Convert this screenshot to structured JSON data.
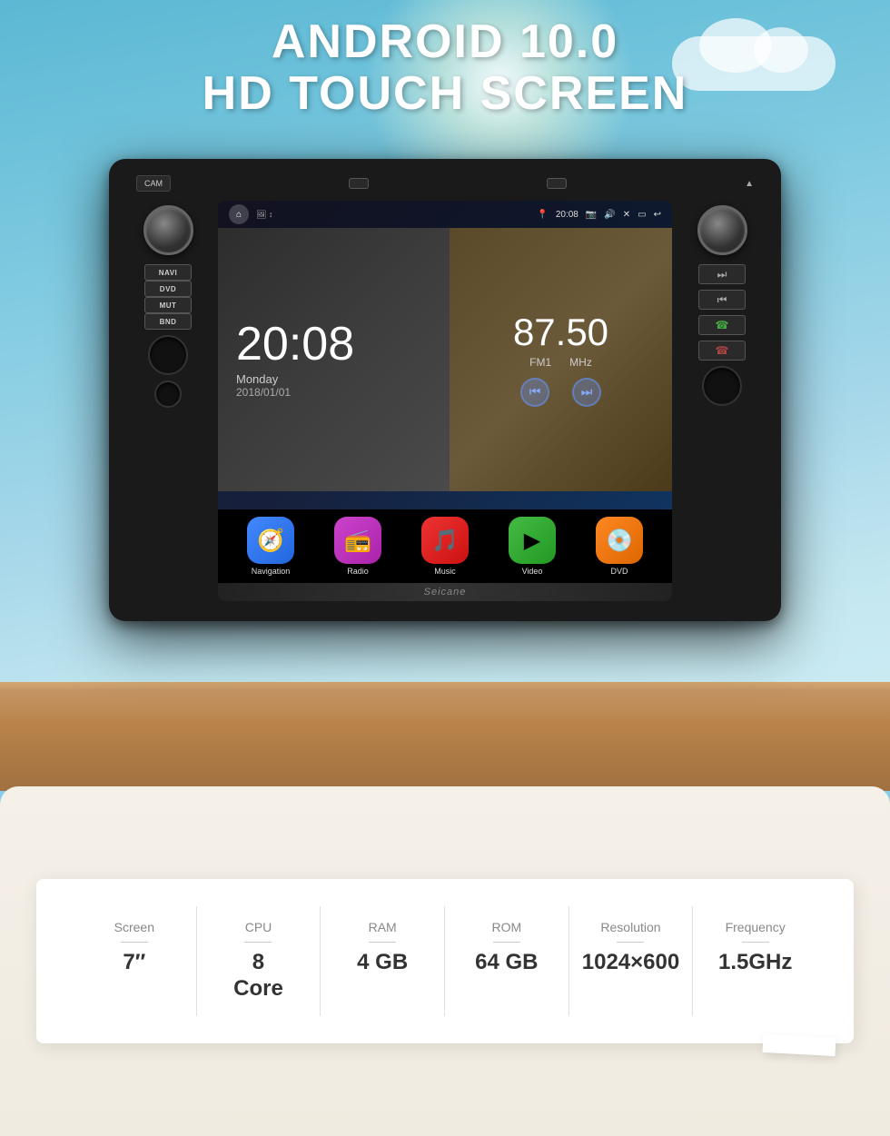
{
  "hero": {
    "title_line1": "ANDROID 10.0",
    "title_line2": "HD TOUCH SCREEN"
  },
  "screen": {
    "time": "20:08",
    "day": "Monday",
    "date": "2018/01/01",
    "freq": "87.50",
    "freq_unit": "MHz",
    "station": "FM1",
    "status_time": "20:08",
    "watermark": "Seicane"
  },
  "apps": [
    {
      "label": "Navigation",
      "color_class": "icon-nav",
      "icon": "🧭"
    },
    {
      "label": "Radio",
      "color_class": "icon-radio",
      "icon": "📻"
    },
    {
      "label": "Music",
      "color_class": "icon-music",
      "icon": "🎵"
    },
    {
      "label": "Video",
      "color_class": "icon-video",
      "icon": "▶"
    },
    {
      "label": "DVD",
      "color_class": "icon-dvd",
      "icon": "💿"
    }
  ],
  "buttons_left": [
    {
      "label": "NAVI"
    },
    {
      "label": "DVD"
    },
    {
      "label": "MUT"
    },
    {
      "label": "BND"
    }
  ],
  "specs": [
    {
      "label": "Screen",
      "value": "7″"
    },
    {
      "label": "CPU",
      "value": "8\nCore"
    },
    {
      "label": "RAM",
      "value": "4 GB"
    },
    {
      "label": "ROM",
      "value": "64 GB"
    },
    {
      "label": "Resolution",
      "value": "1024×600"
    },
    {
      "label": "Frequency",
      "value": "1.5GHz"
    }
  ]
}
